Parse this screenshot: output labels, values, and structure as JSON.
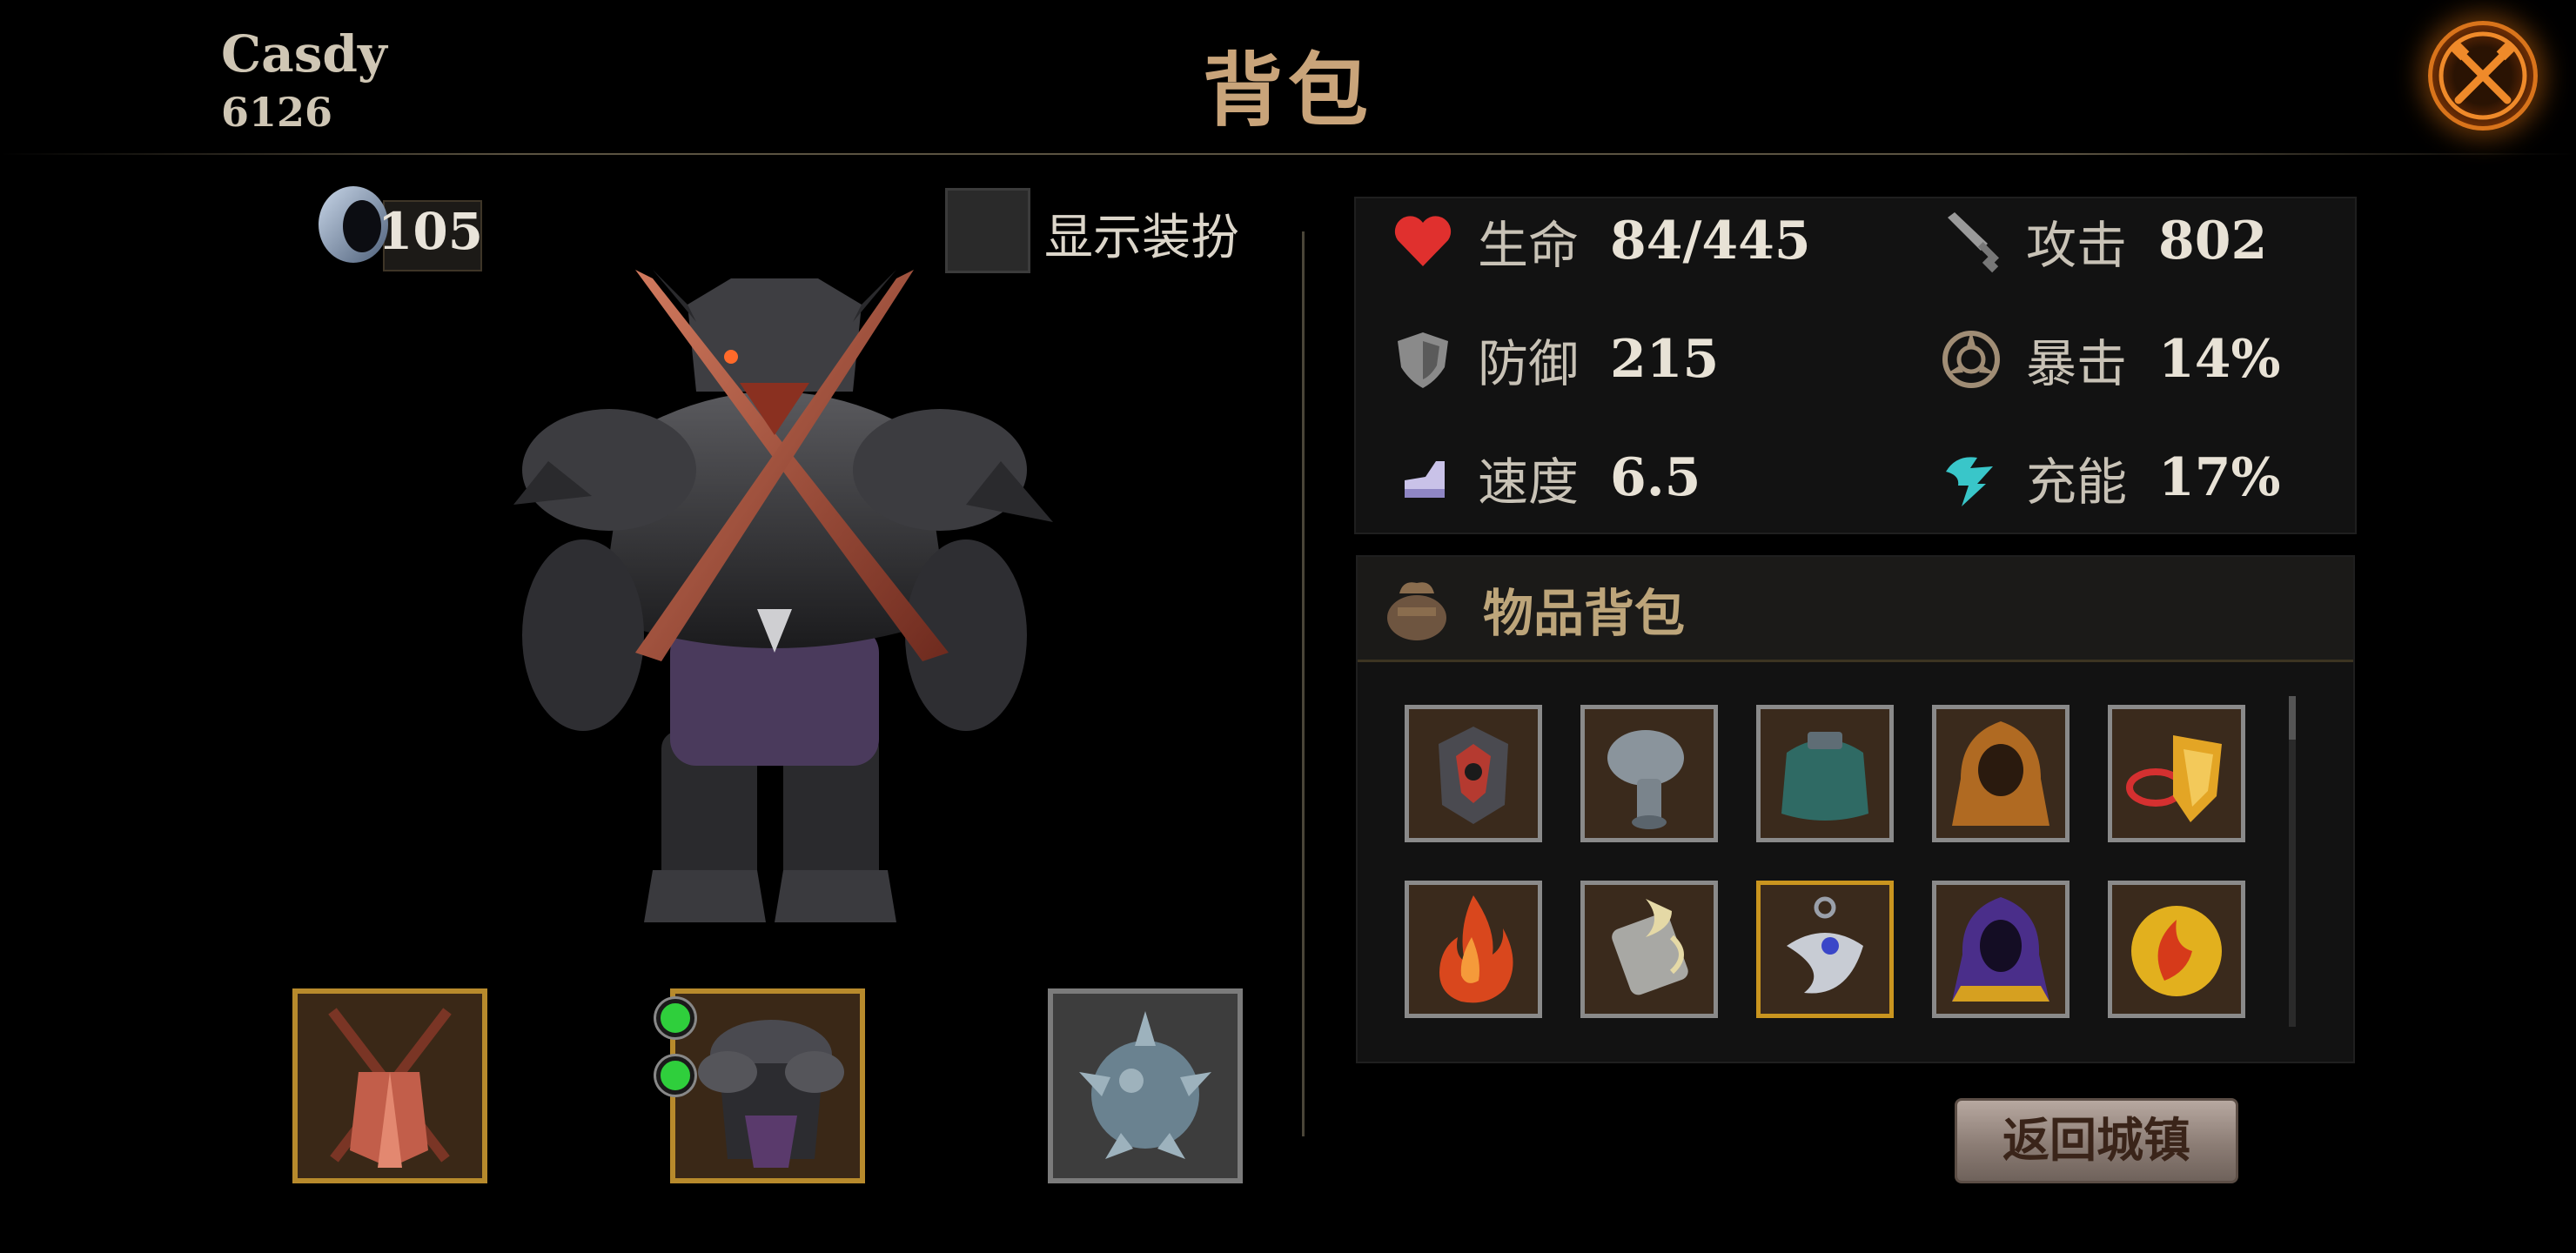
{
  "header": {
    "player_name": "Casdy",
    "player_id": "6126",
    "title": "背包"
  },
  "currency": {
    "value": "105",
    "icon": "ring-icon"
  },
  "outfit": {
    "label": "显示装扮",
    "checked": false
  },
  "stats": {
    "hp_label": "生命",
    "hp_value": "84/445",
    "atk_label": "攻击",
    "atk_value": "802",
    "def_label": "防御",
    "def_value": "215",
    "crit_label": "暴击",
    "crit_value": "14%",
    "spd_label": "速度",
    "spd_value": "6.5",
    "charge_label": "充能",
    "charge_value": "17%"
  },
  "inventory": {
    "title": "物品背包",
    "items": [
      {
        "icon": "helmet-icon",
        "frame": "gray"
      },
      {
        "icon": "gauntlet-icon",
        "frame": "gray"
      },
      {
        "icon": "cape-icon",
        "frame": "gray"
      },
      {
        "icon": "hood-icon",
        "frame": "gray"
      },
      {
        "icon": "shield-ring-icon",
        "frame": "gray"
      },
      {
        "icon": "flame-icon",
        "frame": "gray"
      },
      {
        "icon": "bracer-icon",
        "frame": "gray"
      },
      {
        "icon": "amulet-icon",
        "frame": "gold"
      },
      {
        "icon": "purple-hood-icon",
        "frame": "gray"
      },
      {
        "icon": "fire-orb-icon",
        "frame": "gray"
      }
    ]
  },
  "equipment": [
    {
      "icon": "crossed-swords-icon",
      "frame": "gold",
      "gems": 0
    },
    {
      "icon": "armor-icon",
      "frame": "gold",
      "gems": 2
    },
    {
      "icon": "spiked-ball-icon",
      "frame": "gray",
      "gems": 0
    }
  ],
  "actions": {
    "return_label": "返回城镇"
  },
  "colors": {
    "accent_gold": "#c9a47a",
    "hp_red": "#e0302e",
    "charge_cyan": "#39c6c9"
  }
}
